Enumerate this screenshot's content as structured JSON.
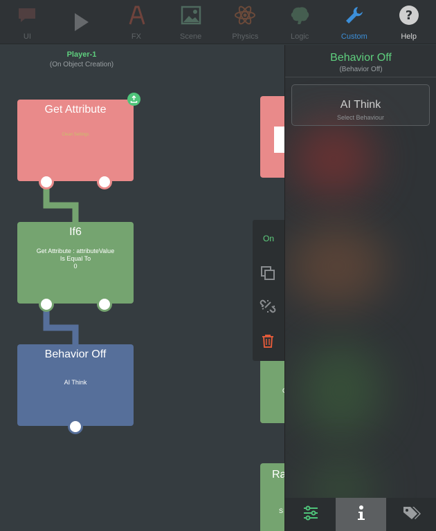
{
  "toolbar": {
    "items": [
      {
        "label": "UI",
        "icon": "chat-bubble-icon"
      },
      {
        "label": "",
        "icon": "play-icon"
      },
      {
        "label": "FX",
        "icon": "fx-icon"
      },
      {
        "label": "Scene",
        "icon": "image-icon"
      },
      {
        "label": "Physics",
        "icon": "atom-icon"
      },
      {
        "label": "Logic",
        "icon": "brain-icon"
      },
      {
        "label": "Custom",
        "icon": "wrench-icon"
      },
      {
        "label": "Help",
        "icon": "help-icon"
      }
    ],
    "active": "Custom"
  },
  "canvas": {
    "object_name": "Player-1",
    "object_event": "(On Object Creation)",
    "nodes": {
      "get_attribute": {
        "title": "Get Attribute",
        "body": "Clean Settings"
      },
      "if6": {
        "title": "If6",
        "line1": "Get Attribute : attributeValue",
        "line2": "Is Equal To",
        "line3": "0"
      },
      "behavior_off": {
        "title": "Behavior Off",
        "body": "AI Think"
      },
      "partial_bottom": {
        "title": "Ra",
        "line1": "S"
      },
      "partial_mid": {
        "body": "G"
      }
    }
  },
  "context_menu": {
    "on_label": "On",
    "icons": [
      "copy-icon",
      "unlink-icon",
      "trash-icon"
    ]
  },
  "panel": {
    "title": "Behavior Off",
    "subtitle": "(Behavior Off)",
    "card_title": "AI Think",
    "card_subtitle": "Select Behaviour",
    "tabs": [
      {
        "icon": "sliders-icon",
        "active": false
      },
      {
        "icon": "info-icon",
        "active": true
      },
      {
        "icon": "tags-icon",
        "active": false
      }
    ]
  },
  "colors": {
    "accent_green": "#5fcf7e",
    "accent_blue": "#3c8fd9",
    "node_red": "#e98a8a",
    "node_green": "#75a470",
    "node_blue": "#566f9a",
    "trash_red": "#e05a3a"
  }
}
